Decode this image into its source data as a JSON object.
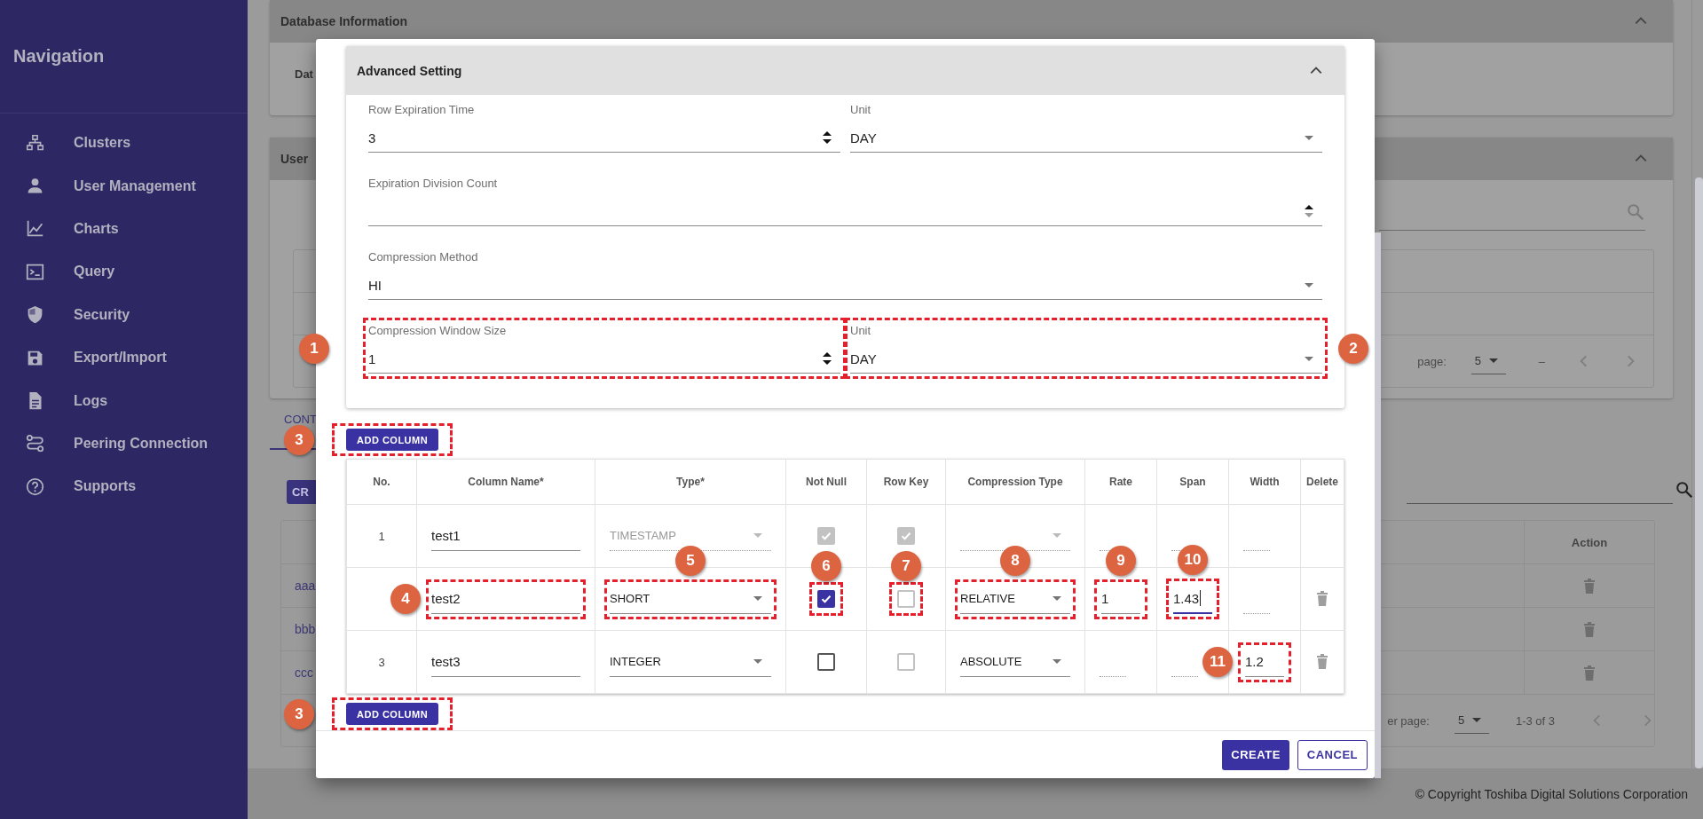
{
  "sidebar": {
    "title": "Navigation",
    "items": [
      {
        "label": "Clusters"
      },
      {
        "label": "User Management"
      },
      {
        "label": "Charts"
      },
      {
        "label": "Query"
      },
      {
        "label": "Security"
      },
      {
        "label": "Export/Import"
      },
      {
        "label": "Logs"
      },
      {
        "label": "Peering Connection"
      },
      {
        "label": "Supports"
      }
    ]
  },
  "background": {
    "database_card": {
      "title": "Database Information",
      "label": "Dat"
    },
    "user_card": {
      "title": "User",
      "pagination": {
        "label": "page:",
        "rows_per_page": "5",
        "range": "–"
      }
    },
    "tab": "CONT",
    "create_button": "CR",
    "table": {
      "action_header": "Action",
      "rows": [
        "aaa",
        "bbb",
        "ccc"
      ]
    },
    "pagination": {
      "label": "er page:",
      "rows_per_page": "5",
      "range": "1-3 of 3"
    }
  },
  "dialog": {
    "panel": {
      "title": "Advanced Setting",
      "expanded": true,
      "rows": [
        [
          {
            "kind": "number",
            "label": "Row Expiration Time",
            "value": "3"
          },
          {
            "kind": "select",
            "label": "Unit",
            "value": "DAY"
          }
        ],
        [
          {
            "kind": "number",
            "label": "Expiration Division Count"
          }
        ],
        [
          {
            "kind": "select",
            "label": "Compression Method",
            "value": "HI"
          }
        ],
        [
          {
            "kind": "number",
            "label": "Compression Window Size",
            "value": "1",
            "callout": {
              "label": "1"
            }
          },
          {
            "kind": "select",
            "label": "Unit",
            "value": "DAY",
            "callout": {
              "label": "2"
            }
          }
        ]
      ]
    },
    "add_column_top": {
      "label": "ADD COLUMN",
      "callout": {
        "label": "3"
      }
    },
    "table": {
      "columns": [
        "No.",
        "Column Name*",
        "Type*",
        "Not Null",
        "Row Key",
        "Compression Type",
        "Rate",
        "Span",
        "Width",
        "Delete"
      ],
      "rows": [
        {
          "no": "1",
          "name": {
            "value": "test1"
          },
          "type": {
            "value": "TIMESTAMP",
            "disabled": true
          },
          "not_null": {
            "checked": true,
            "disabled": true
          },
          "row_key": {
            "checked": true,
            "disabled": true
          },
          "compression_type": {
            "disabled": true
          },
          "rate": {
            "disabled": true
          },
          "span": {
            "disabled": true
          },
          "width": {
            "disabled": true
          },
          "deletable": false
        },
        {
          "name": {
            "value": "test2",
            "callout": {
              "label": "4"
            }
          },
          "type": {
            "value": "SHORT",
            "disabled": false,
            "callout": {
              "label": "5"
            }
          },
          "not_null": {
            "checked": true,
            "disabled": false,
            "callout": {
              "label": "6"
            }
          },
          "row_key": {
            "checked": false,
            "disabled": true,
            "callout": {
              "label": "7"
            }
          },
          "compression_type": {
            "value": "RELATIVE",
            "disabled": false,
            "callout": {
              "label": "8"
            }
          },
          "rate": {
            "value": "1",
            "disabled": false,
            "callout": {
              "label": "9"
            }
          },
          "span": {
            "value": "1.43",
            "disabled": false,
            "focused": true,
            "callout": {
              "label": "10"
            }
          },
          "width": {
            "disabled": true
          },
          "deletable": true
        },
        {
          "no": "3",
          "name": {
            "value": "test3"
          },
          "type": {
            "value": "INTEGER",
            "disabled": false
          },
          "not_null": {
            "checked": false,
            "disabled": false
          },
          "row_key": {
            "checked": false,
            "disabled": true
          },
          "compression_type": {
            "value": "ABSOLUTE",
            "disabled": false
          },
          "rate": {
            "disabled": true
          },
          "span": {
            "disabled": true
          },
          "width": {
            "value": "1.2",
            "disabled": false,
            "callout": {
              "label": "11"
            }
          },
          "deletable": true
        }
      ]
    },
    "add_column_bottom": {
      "label": "ADD COLUMN",
      "callout": {
        "label": "3"
      }
    },
    "buttons": [
      {
        "label": "CREATE",
        "kind": "primary"
      },
      {
        "label": "CANCEL",
        "kind": "outlined"
      }
    ]
  },
  "copyright": "© Copyright Toshiba Digital Solutions Corporation"
}
